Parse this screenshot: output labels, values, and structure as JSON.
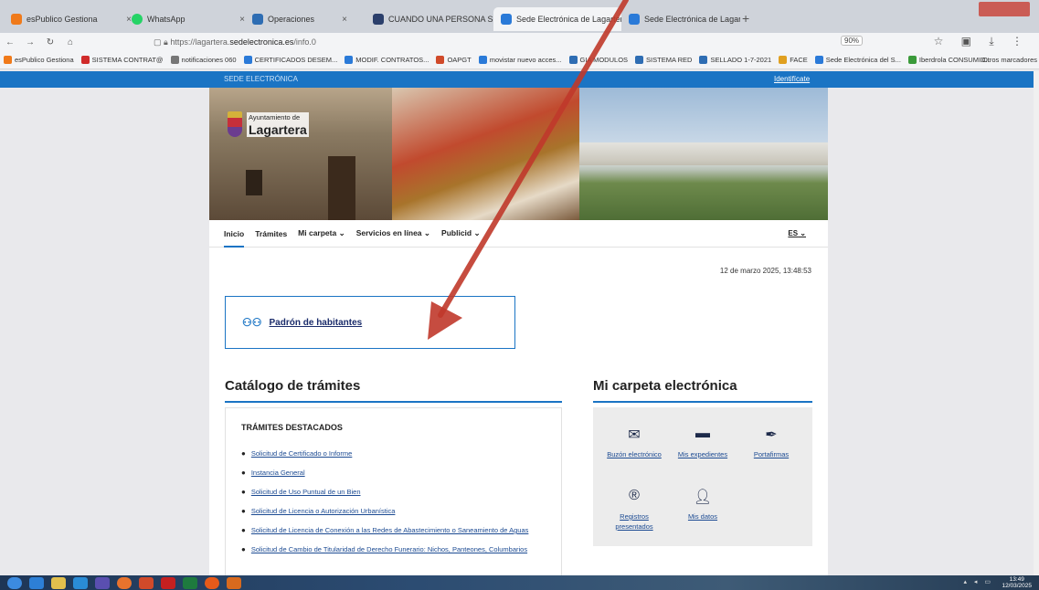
{
  "browser": {
    "tabs": [
      {
        "label": "esPublico Gestiona",
        "color": "#f07a1a"
      },
      {
        "label": "WhatsApp",
        "color": "#25d366"
      },
      {
        "label": "Operaciones",
        "color": "#2e6db3"
      },
      {
        "label": "CUANDO UNA PERSONA SE C",
        "color": "#2b3f6b"
      },
      {
        "label": "Sede Electrónica de Lagartera",
        "color": "#2a7ad8"
      },
      {
        "label": "Sede Electrónica de Lagartera",
        "color": "#2a7ad8"
      }
    ],
    "url_prefix": "https://lagartera.",
    "url_host": "sedelectronica.es",
    "url_path": "/info.0",
    "zoom": "90%",
    "bookmarks": [
      {
        "label": "esPublico Gestiona",
        "color": "#f07a1a"
      },
      {
        "label": "SISTEMA CONTRAT@",
        "color": "#d02b2b"
      },
      {
        "label": "notificaciones 060",
        "color": "#777777"
      },
      {
        "label": "CERTIFICADOS DESEM...",
        "color": "#2a7ad8"
      },
      {
        "label": "MODIF. CONTRATOS...",
        "color": "#2a7ad8"
      },
      {
        "label": "OAPGT",
        "color": "#d04a2a"
      },
      {
        "label": "movistar nuevo acces...",
        "color": "#2a7ad8"
      },
      {
        "label": "GIA MODULOS",
        "color": "#2e6db3"
      },
      {
        "label": "SISTEMA RED",
        "color": "#2e6db3"
      },
      {
        "label": "SELLADO 1-7-2021",
        "color": "#2e6db3"
      },
      {
        "label": "FACE",
        "color": "#e0a020"
      },
      {
        "label": "Sede Electrónica del S...",
        "color": "#2a7ad8"
      },
      {
        "label": "Iberdrola CONSUMID...",
        "color": "#3a9a3a"
      }
    ],
    "other_bookmarks": "Otros marcadores"
  },
  "sede": {
    "label": "SEDE ELECTRÓNICA",
    "login": "Identifícate"
  },
  "logo": {
    "small": "Ayuntamiento de",
    "big": "Lagartera"
  },
  "menu": {
    "items": [
      "Inicio",
      "Trámites",
      "Mi carpeta",
      "Servicios en línea",
      "Publicid"
    ],
    "lang": "ES"
  },
  "date": "12 de marzo 2025, 13:48:53",
  "padron": "Padrón de habitantes",
  "catalog": {
    "heading": "Catálogo de trámites",
    "title": "TRÁMITES DESTACADOS",
    "items": [
      "Solicitud de Certificado o Informe",
      "Instancia General",
      "Solicitud de Uso Puntual de un Bien",
      "Solicitud de Licencia o Autorización Urbanística",
      "Solicitud de Licencia de Conexión a las Redes de Abastecimiento o Saneamiento de Aguas",
      "Solicitud de Cambio de Titularidad de Derecho Funerario: Nichos, Panteones, Columbarios"
    ]
  },
  "carpeta": {
    "heading": "Mi carpeta electrónica",
    "cells": [
      {
        "label": "Buzón electrónico",
        "icon": "envelope-icon"
      },
      {
        "label": "Mis expedientes",
        "icon": "folder-icon"
      },
      {
        "label": "Portafirmas",
        "icon": "pen-icon"
      },
      {
        "label": "Registros presentados",
        "icon": "registered-icon"
      },
      {
        "label": "Mis datos",
        "icon": "user-icon"
      }
    ]
  },
  "taskbar": {
    "clock_time": "13:49",
    "clock_date": "12/03/2025"
  }
}
